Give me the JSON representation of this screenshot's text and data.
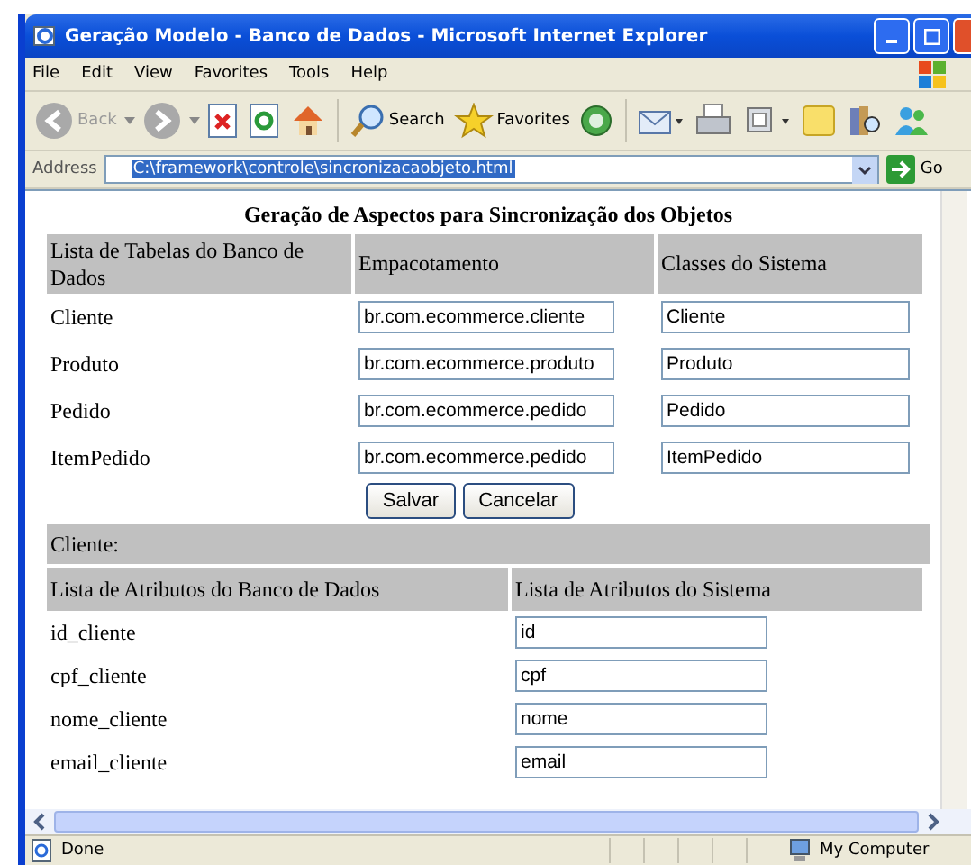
{
  "window": {
    "title": "Geração Modelo - Banco de Dados - Microsoft Internet Explorer"
  },
  "menu": [
    {
      "label": "File"
    },
    {
      "label": "Edit"
    },
    {
      "label": "View"
    },
    {
      "label": "Favorites"
    },
    {
      "label": "Tools"
    },
    {
      "label": "Help"
    }
  ],
  "toolbar": [
    {
      "kind": "back",
      "label": "Back",
      "disabled": true
    },
    {
      "kind": "forward",
      "disabled": true
    },
    {
      "kind": "stop"
    },
    {
      "kind": "refresh"
    },
    {
      "kind": "home"
    },
    {
      "kind": "search",
      "label": "Search"
    },
    {
      "kind": "favorites",
      "label": "Favorites"
    },
    {
      "kind": "media"
    },
    {
      "kind": "mail"
    },
    {
      "kind": "print"
    },
    {
      "kind": "edit"
    },
    {
      "kind": "note"
    },
    {
      "kind": "research"
    },
    {
      "kind": "messenger"
    }
  ],
  "address": {
    "label": "Address",
    "value": "C:\\framework\\controle\\sincronizacaobjeto.html",
    "go": "Go"
  },
  "page": {
    "heading": "Geração de Aspectos para Sincronização dos Objetos",
    "tables": {
      "columns": [
        "Lista de Tabelas do Banco de Dados",
        "Empacotamento",
        "Classes do Sistema"
      ],
      "rows": [
        {
          "table": "Cliente",
          "package": "br.com.ecommerce.cliente",
          "class": "Cliente"
        },
        {
          "table": "Produto",
          "package": "br.com.ecommerce.produto",
          "class": "Produto"
        },
        {
          "table": "Pedido",
          "package": "br.com.ecommerce.pedido",
          "class": "Pedido"
        },
        {
          "table": "ItemPedido",
          "package": "br.com.ecommerce.pedido",
          "class": "ItemPedido"
        }
      ]
    },
    "buttons": [
      "Salvar",
      "Cancelar"
    ],
    "section": "Cliente:",
    "attributes": {
      "columns": [
        "Lista de Atributos do Banco de Dados",
        "Lista de Atributos do Sistema"
      ],
      "rows": [
        {
          "db": "id_cliente",
          "sys": "id"
        },
        {
          "db": "cpf_cliente",
          "sys": "cpf"
        },
        {
          "db": "nome_cliente",
          "sys": "nome"
        },
        {
          "db": "email_cliente",
          "sys": "email"
        }
      ]
    }
  },
  "status_bar": {
    "text": "Done",
    "zone": "My Computer"
  }
}
